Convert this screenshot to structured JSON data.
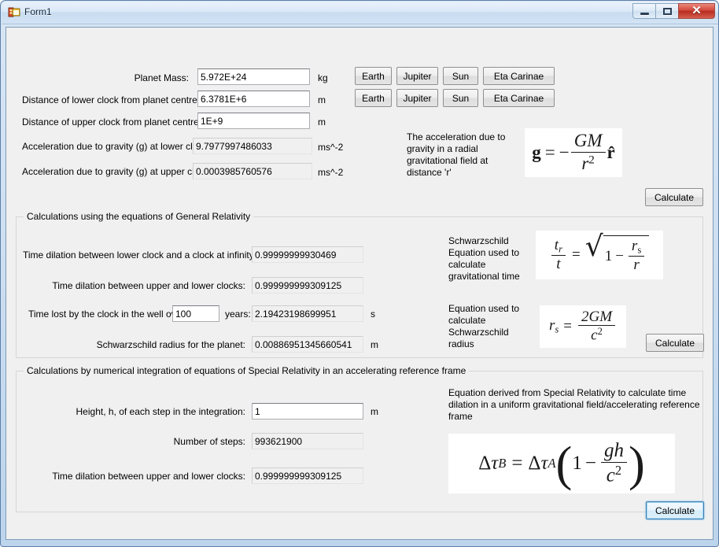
{
  "window": {
    "title": "Form1",
    "app_icon": "winforms-icon",
    "controls": {
      "minimize": "minimize-icon",
      "maximize": "maximize-icon",
      "close": "✕"
    }
  },
  "top_section": {
    "rows": [
      {
        "label": "Planet Mass:",
        "value": "5.972E+24",
        "unit": "kg",
        "readonly": false
      },
      {
        "label": "Distance of lower clock from planet centre:",
        "value": "6.3781E+6",
        "unit": "m",
        "readonly": false
      },
      {
        "label": "Distance of upper clock from planet centre:",
        "value": "1E+9",
        "unit": "m",
        "readonly": false
      },
      {
        "label": "Acceleration due to gravity (g) at lower clock:",
        "value": "9.7977997486033",
        "unit": "ms^-2",
        "readonly": true
      },
      {
        "label": "Acceleration due to gravity (g) at upper clock:",
        "value": "0.0003985760576",
        "unit": "ms^-2",
        "readonly": true
      }
    ],
    "preset_row_1": [
      "Earth",
      "Jupiter",
      "Sun",
      "Eta Carinae"
    ],
    "preset_row_2": [
      "Earth",
      "Jupiter",
      "Sun",
      "Eta Carinae"
    ],
    "equation_description": "The acceleration due to gravity in a radial gravitational field at distance 'r'",
    "equation_alt": "g = -GM/r^2 r-hat",
    "calculate_label": "Calculate"
  },
  "gr_section": {
    "caption": "Calculations using the equations of General Relativity",
    "rows": [
      {
        "label": "Time dilation between lower clock and a clock at infinity:",
        "value": "0.99999999930469",
        "unit": ""
      },
      {
        "label": "Time dilation between upper and lower clocks:",
        "value": "0.999999999309125",
        "unit": ""
      },
      {
        "label": "Schwarzschild radius for the planet:",
        "value": "0.00886951345660541",
        "unit": "m"
      }
    ],
    "time_lost": {
      "label_before": "Time lost by the clock in the well over",
      "years_value": "100",
      "label_after": "years:",
      "result": "2.19423198699951",
      "unit": "s"
    },
    "equation_1_description": "Schwarzschild Equation used to calculate gravitational time",
    "equation_1_alt": "t_r / t = sqrt(1 - r_s / r)",
    "equation_2_description": "Equation used to calculate Schwarzschild radius",
    "equation_2_alt": "r_s = 2GM / c^2",
    "calculate_label": "Calculate"
  },
  "sr_section": {
    "caption": "Calculations by numerical integration of equations of Special Relativity in an accelerating reference frame",
    "rows": [
      {
        "label": "Height, h, of each step in the integration:",
        "value": "1",
        "unit": "m",
        "readonly": false
      },
      {
        "label": "Number of steps:",
        "value": "993621900",
        "unit": "",
        "readonly": true
      },
      {
        "label": "Time dilation between upper and lower clocks:",
        "value": "0.999999999309125",
        "unit": "",
        "readonly": true
      }
    ],
    "equation_description": "Equation derived from Special Relativity to calculate time dilation in a uniform gravitational field/accelerating reference frame",
    "equation_alt": "delta tau_B = delta tau_A (1 - gh/c^2)",
    "calculate_label": "Calculate"
  },
  "math": {
    "g_bold": "g",
    "equals": "=",
    "minus": "−",
    "GM": "GM",
    "r": "r",
    "two": "2",
    "rhat": "r̂",
    "t": "t",
    "s": "s",
    "one": "1",
    "rs_num": "2GM",
    "c": "c",
    "delta": "Δ",
    "tau": "τ",
    "A": "A",
    "B": "B",
    "gh": "gh"
  }
}
